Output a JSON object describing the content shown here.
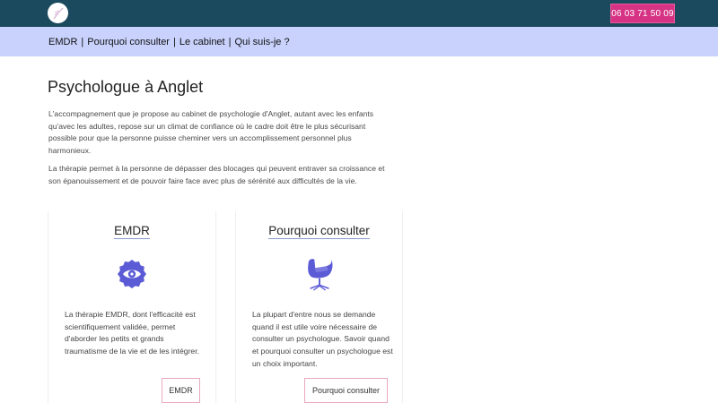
{
  "header": {
    "logo_icon": "feather-logo-icon",
    "phone": "06 03 71 50 09",
    "colors": {
      "topbar": "#1b4a5e",
      "phone_button": "#d63384",
      "navbar": "#c8d2fc",
      "accent_icon": "#5b5bd6"
    }
  },
  "nav": {
    "items": [
      {
        "label": "EMDR"
      },
      {
        "label": "Pourquoi consulter"
      },
      {
        "label": "Le cabinet"
      },
      {
        "label": "Qui suis-je ?"
      }
    ],
    "separator": "|"
  },
  "main": {
    "title": "Psychologue à Anglet",
    "paragraphs": [
      "L'accompagnement que je propose au cabinet de psychologie d'Anglet, autant avec les enfants qu'avec les adultes, repose sur un climat de confiance où le cadre doit être le plus sécurisant possible pour que la personne puisse cheminer vers un accomplissement personnel plus harmonieux.",
      "La thérapie permet à la personne de dépasser des blocages qui peuvent entraver sa croissance et son épanouissement et de pouvoir faire face avec plus de sérénité aux difficultés de la vie."
    ]
  },
  "cards": [
    {
      "title": "EMDR",
      "icon": "eye-badge-icon",
      "text": "La thérapie EMDR, dont l'efficacité est scientifiquement validée, permet d'aborder les petits et grands traumatisme de la vie et de les intégrer.",
      "button": "EMDR"
    },
    {
      "title": "Pourquoi consulter",
      "icon": "egg-chair-icon",
      "text": "La plupart d'entre nous se demande quand il est utile voire nécessaire de consulter un psychologue. Savoir quand et pourquoi consulter un psychologue est un choix important.",
      "button": "Pourquoi consulter"
    }
  ]
}
